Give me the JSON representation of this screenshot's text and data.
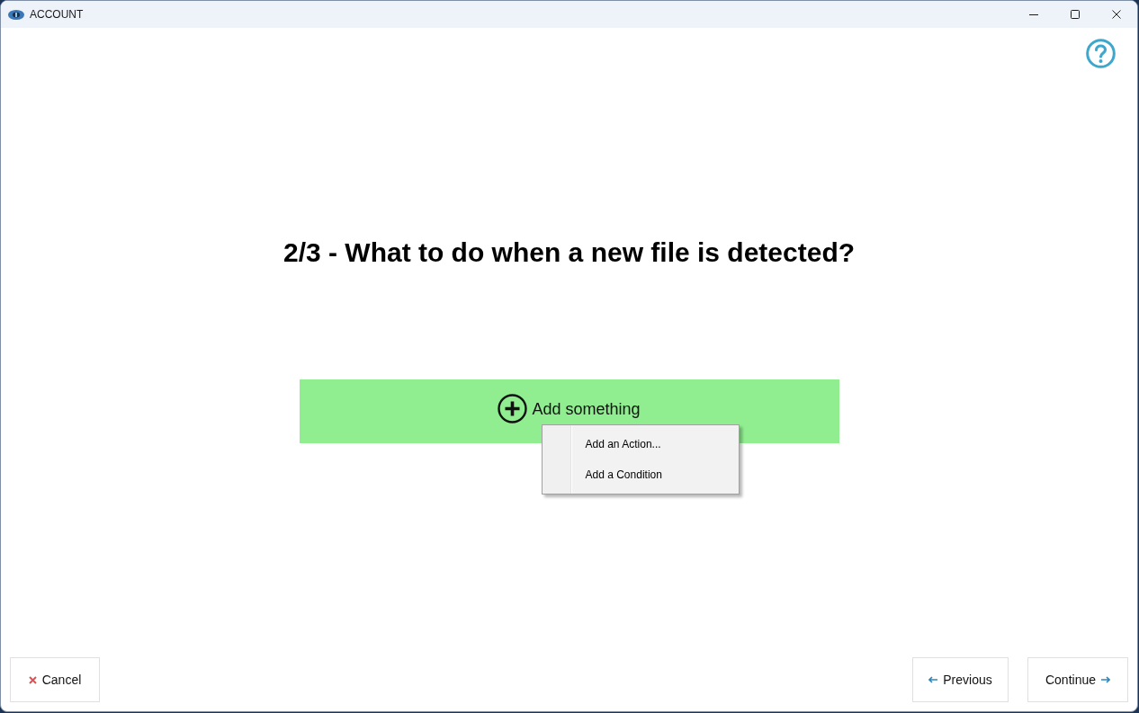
{
  "window": {
    "title": "ACCOUNT"
  },
  "heading": "2/3 - What to do when a new file is detected?",
  "add_bar": {
    "label": "Add something"
  },
  "context_menu": {
    "items": [
      {
        "label": "Add an Action..."
      },
      {
        "label": "Add a Condition"
      }
    ]
  },
  "footer": {
    "buttons": [
      {
        "kind": "cancel",
        "label": "Cancel"
      },
      {
        "kind": "previous",
        "label": "Previous"
      },
      {
        "kind": "continue",
        "label": "Continue"
      }
    ]
  }
}
